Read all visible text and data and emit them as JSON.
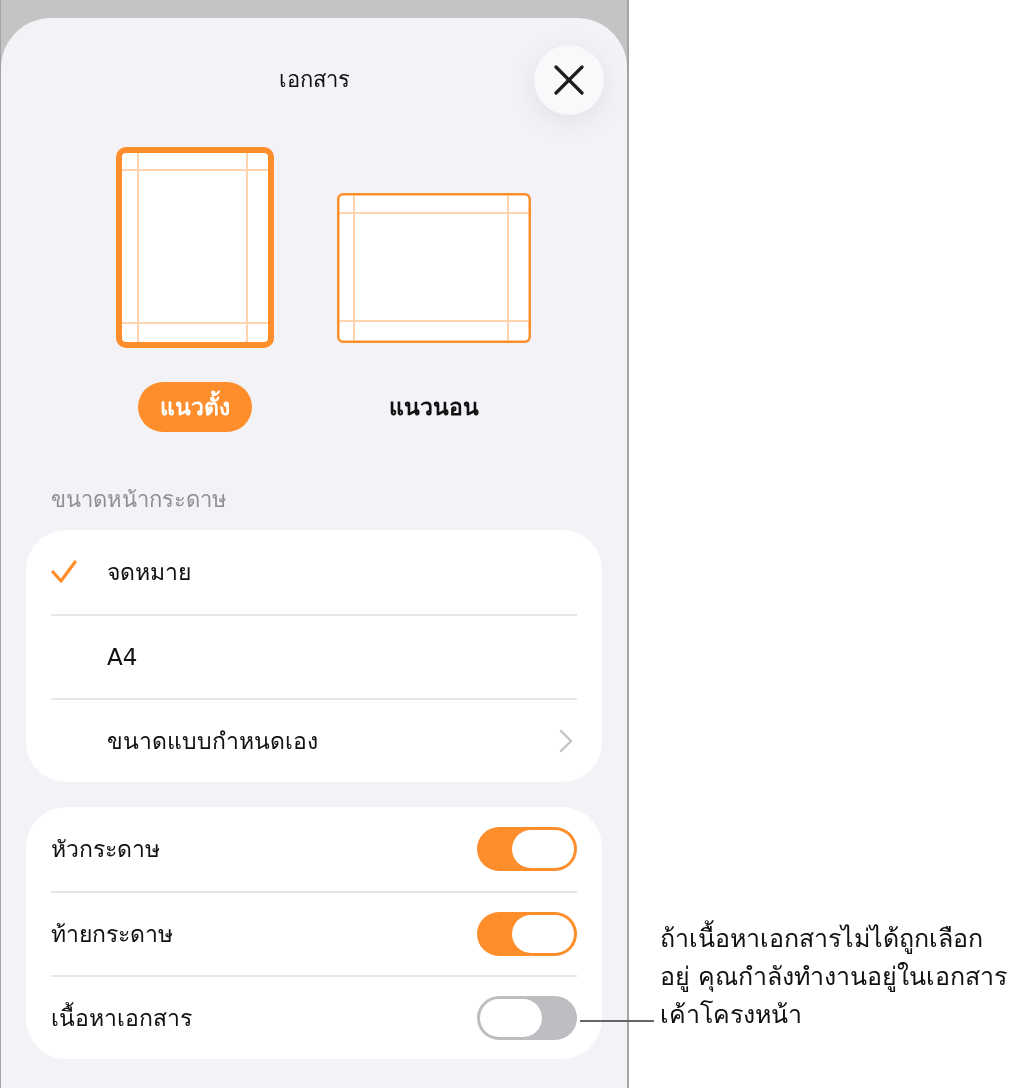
{
  "sheet": {
    "title": "เอกสาร"
  },
  "orientations": [
    {
      "kind": "portrait",
      "label": "แนวตั้ง",
      "selected": true
    },
    {
      "kind": "landscape",
      "label": "แนวนอน",
      "selected": false
    }
  ],
  "paper_size": {
    "heading": "ขนาดหน้ากระดาษ",
    "options": [
      {
        "kind": "size",
        "label": "จดหมาย",
        "selected": true
      },
      {
        "kind": "size",
        "label": "A4",
        "selected": false
      },
      {
        "kind": "custom",
        "label": "ขนาดแบบกำหนดเอง",
        "selected": false
      }
    ]
  },
  "toggles": [
    {
      "label": "หัวกระดาษ",
      "on": true
    },
    {
      "label": "ท้ายกระดาษ",
      "on": true
    },
    {
      "label": "เนื้อหาเอกสาร",
      "on": false
    }
  ],
  "callout": {
    "lines": [
      "ถ้าเนื้อหาเอกสารไม่ได้ถูกเลือก",
      "อยู่ คุณกำลังทำงานอยู่ในเอกสาร",
      "เค้าโครงหน้า"
    ]
  }
}
